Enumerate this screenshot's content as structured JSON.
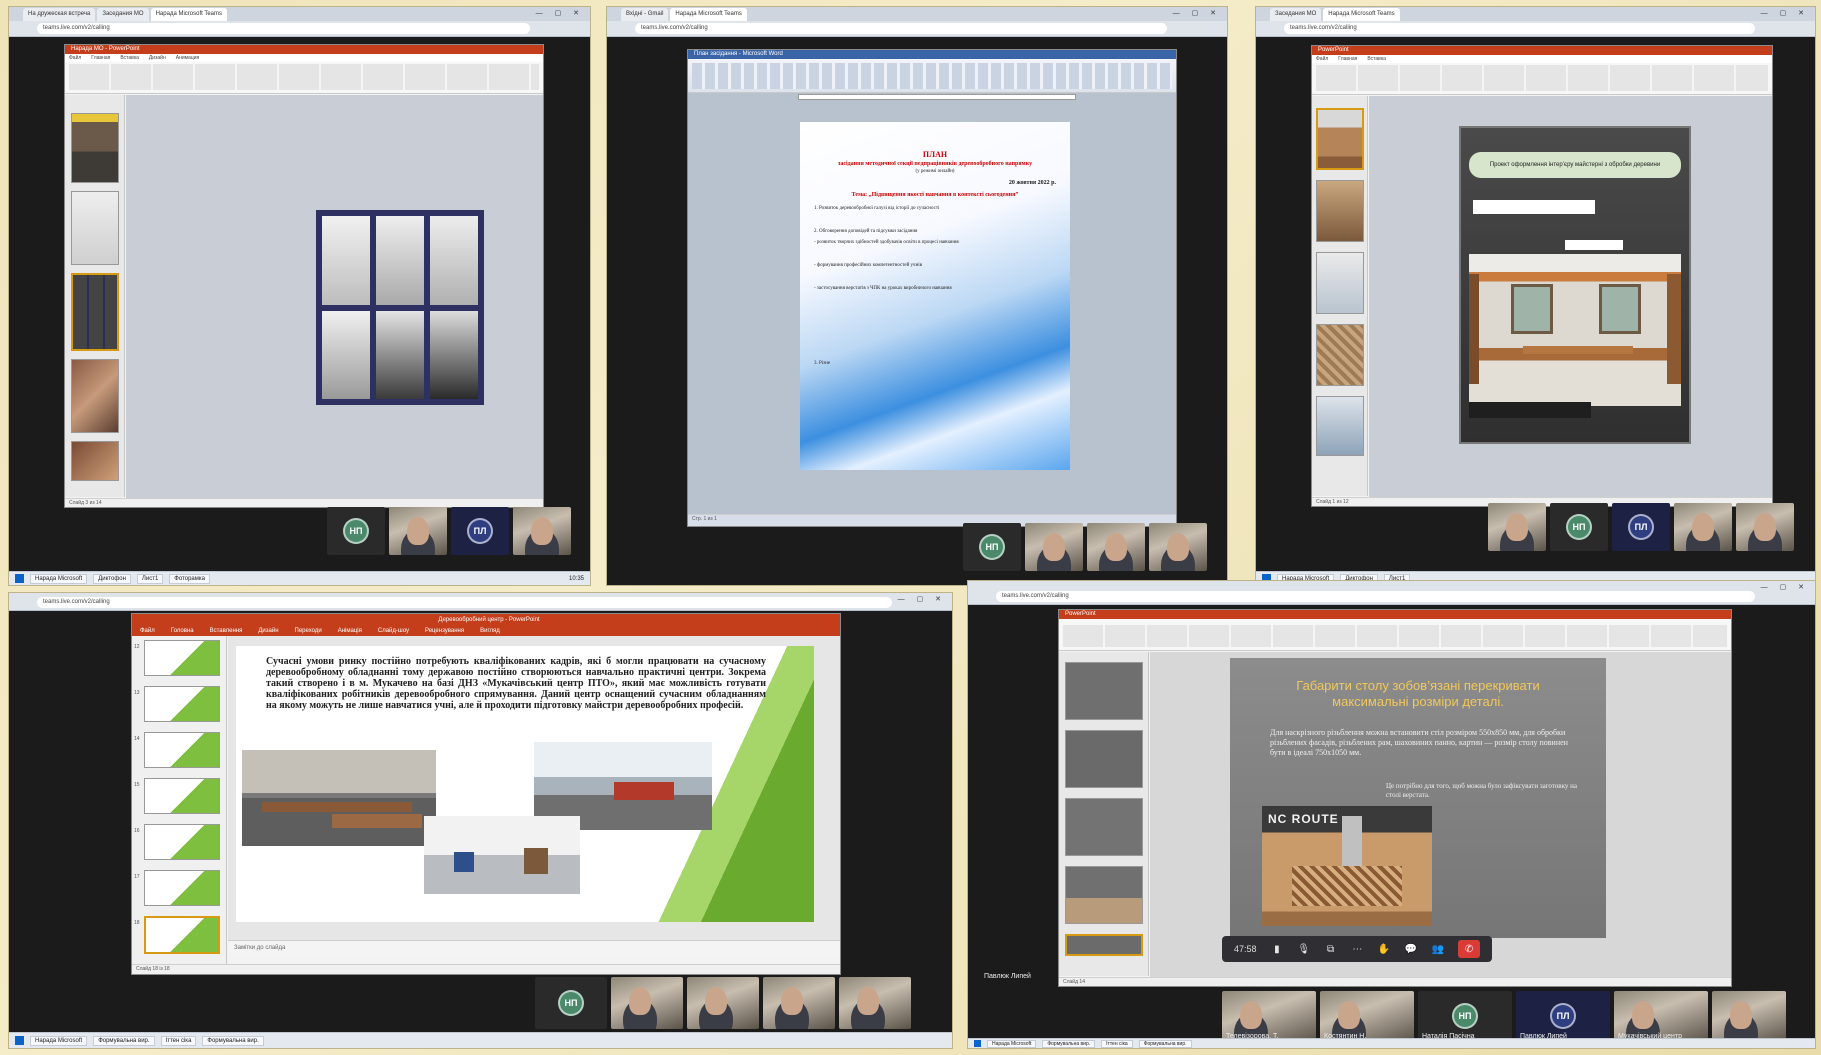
{
  "panels": {
    "p1": {
      "tabs": [
        "На дружеская встреча",
        "Заседания МО",
        "Нарада Microsoft Teams"
      ],
      "url": "teams.live.com/v2/calling",
      "ppt_title": "Нарада МО - PowerPoint",
      "avatars": [
        {
          "initials": "НП",
          "color": "#4a8a6a"
        },
        {
          "initials": "ПЛ",
          "color": "#2e3e80"
        }
      ],
      "taskbar": [
        "Нарада Microsoft",
        "Диктофон",
        "Лист1",
        "Фоторамка"
      ],
      "clock": "10:35"
    },
    "p2": {
      "tabs": [
        "Вхідні - Gmail",
        "Нарада Microsoft Teams"
      ],
      "url": "teams.live.com/v2/calling",
      "word_title": "План засідання - Microsoft Word",
      "doc": {
        "heading": "ПЛАН",
        "subheading": "засідання методичної секції педпрацівників деревообробного напрямку",
        "note": "(у режимі онлайн)",
        "date": "20 жовтня 2022 р.",
        "theme": "Тема: „Підвищення якості навчання в контексті сьогодення”",
        "lines": [
          "1. Розвиток деревообробної галузі від історії до сучасності",
          "2. Обговорення доповідей та підсумки засідання",
          "- розвиток творчих здібностей здобувачів освіти в процесі навчання",
          "- формування професійних компетентностей учнів",
          "- застосування верстатів з ЧПК на уроках виробничого навчання",
          "3. Різне"
        ]
      },
      "avatars": [
        {
          "initials": "НП",
          "color": "#4a8a6a"
        }
      ]
    },
    "p3": {
      "tabs": [
        "Заседания МО",
        "Нарада Microsoft Teams"
      ],
      "url": "teams.live.com/v2/calling",
      "slide_title": "Проект оформлення інтер’єру майстерні з обробки деревини",
      "avatars": [
        {
          "initials": "НП",
          "color": "#4a8a6a"
        },
        {
          "initials": "ПЛ",
          "color": "#2e3e80"
        }
      ],
      "taskbar": [
        "Нарада Microsoft",
        "Диктофон",
        "Лист1"
      ]
    },
    "p4": {
      "url": "teams.live.com/v2/calling",
      "ppt_title": "Деревообробний центр - PowerPoint",
      "ribbon_tabs": [
        "Файл",
        "Головна",
        "Вставлення",
        "Дизайн",
        "Переходи",
        "Анімація",
        "Слайд-шоу",
        "Рецензування",
        "Вигляд"
      ],
      "slide_paragraph": "Сучасні умови ринку постійно потребують кваліфікованих кадрів, які б могли працювати на сучасному деревообробному обладнанні тому державою постійно створюються навчально практичні центри. Зокрема такий створено і в м. Мукачево на базі ДНЗ «Мукачівський центр ПТО», який має можливість готувати кваліфікованих робітників деревообробного спрямування. Даний центр оснащений сучасним обладнанням на якому можуть не лише навчатися учні, але й проходити підготовку майстри деревообробних професій.",
      "notes": "Замітки до слайда",
      "status": "Слайд 18 із 18",
      "thumb_numbers": [
        "12",
        "13",
        "14",
        "15",
        "16",
        "17",
        "18"
      ],
      "avatars": [
        {
          "initials": "НП",
          "color": "#4a8a6a"
        }
      ],
      "taskbar": [
        "Нарада Microsoft",
        "Формувальна вир.",
        "Іттен сіка",
        "Формувальна вир."
      ]
    },
    "p5": {
      "url": "teams.live.com/v2/calling",
      "slide_heading": "Габарити столу зобов’язані перекривати максимальні розміри деталі.",
      "slide_bullets": [
        "Для наскрізного різьблення можна встановити стіл розміром 550х850 мм, для обробки різьблених фасадів, різьблених рам, шаховиних панно, картин — розмір столу повинен бути в ідеалі 750х1050 мм.",
        "Це потрібно для того, щоб можна було зафіксувати заготовку на столі верстата."
      ],
      "photo_label": "NC ROUTE",
      "call_time": "47:58",
      "presenter": "Павлюк Липей",
      "names": [
        "Телевізорова, Т.",
        "Костянтин Н.",
        "Наталія Пасічна",
        "Павлюк Липей",
        "Мукачівський центр"
      ],
      "avatars": [
        {
          "initials": "НП",
          "color": "#4a8a6a"
        },
        {
          "initials": "ПЛ",
          "color": "#2e3e80"
        }
      ],
      "taskbar": [
        "Нарада Microsoft",
        "Формувальна вир.",
        "Іттен сіка",
        "Формувальна вир."
      ]
    }
  }
}
